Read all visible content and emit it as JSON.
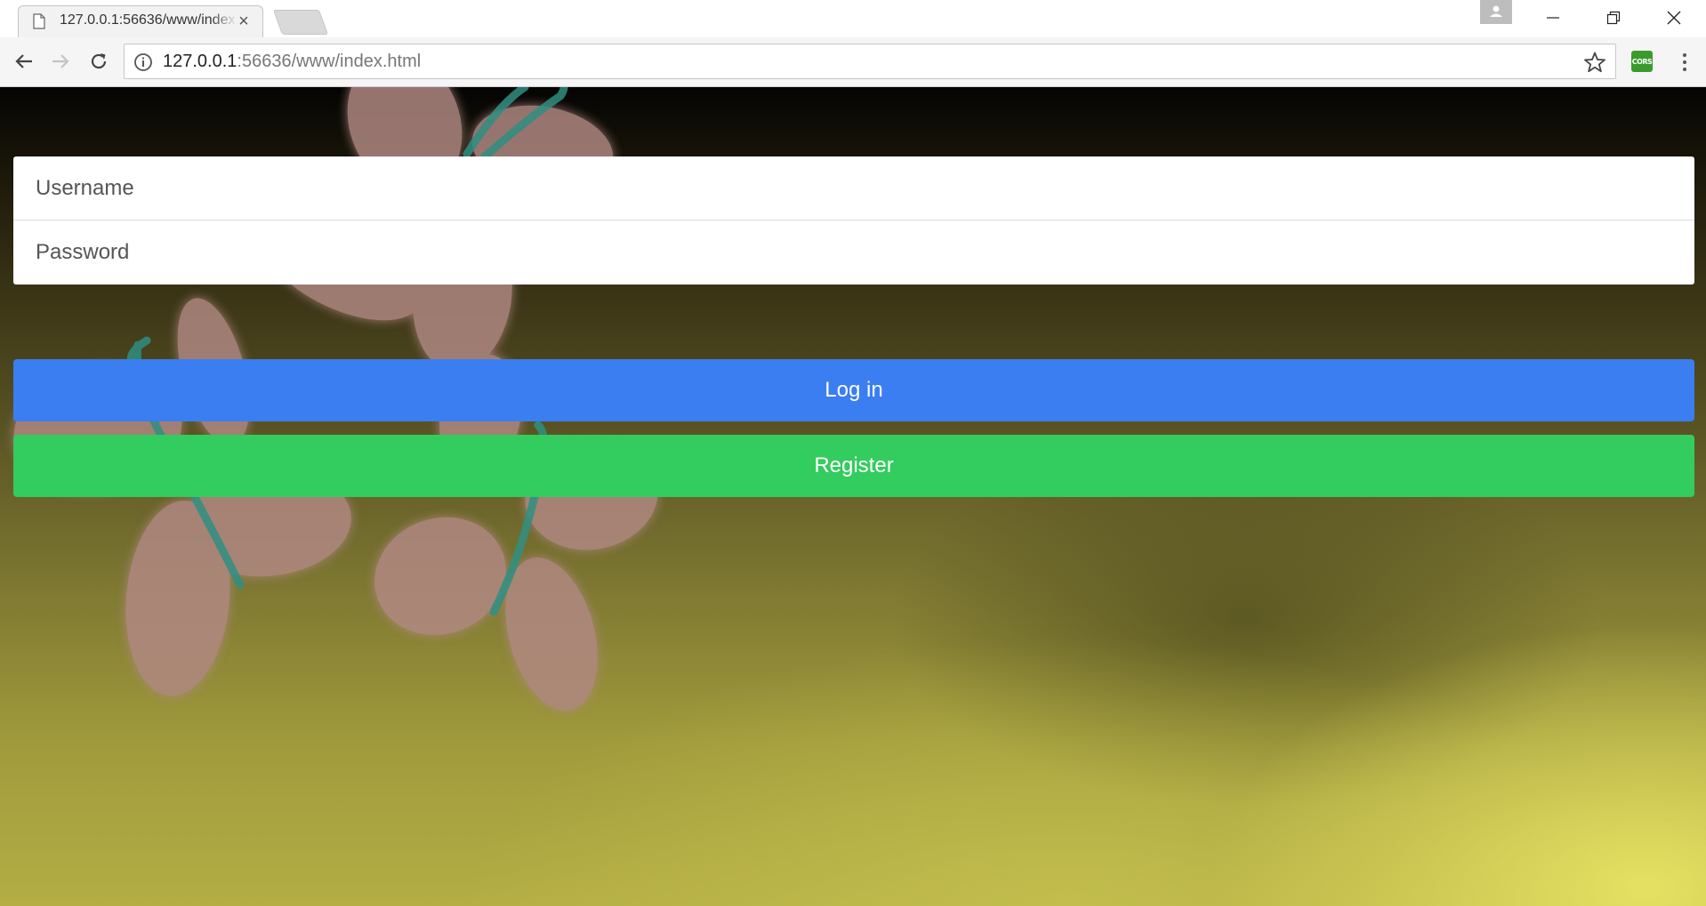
{
  "browser": {
    "tab_title": "127.0.0.1:56636/www/index.html",
    "url_host": "127.0.0.1",
    "url_rest": ":56636/www/index.html",
    "extension_label": "CORS",
    "icons": {
      "back": "arrow-left-icon",
      "forward": "arrow-right-icon",
      "reload": "reload-icon",
      "info": "info-icon",
      "bookmark": "star-icon",
      "menu": "three-dot-menu-icon",
      "minimize": "minimize-icon",
      "restore": "restore-icon",
      "close": "close-icon"
    }
  },
  "login": {
    "username_placeholder": "Username",
    "password_placeholder": "Password",
    "login_label": "Log in",
    "register_label": "Register"
  },
  "colors": {
    "login_button": "#3b7ef1",
    "register_button": "#33cc5f"
  }
}
